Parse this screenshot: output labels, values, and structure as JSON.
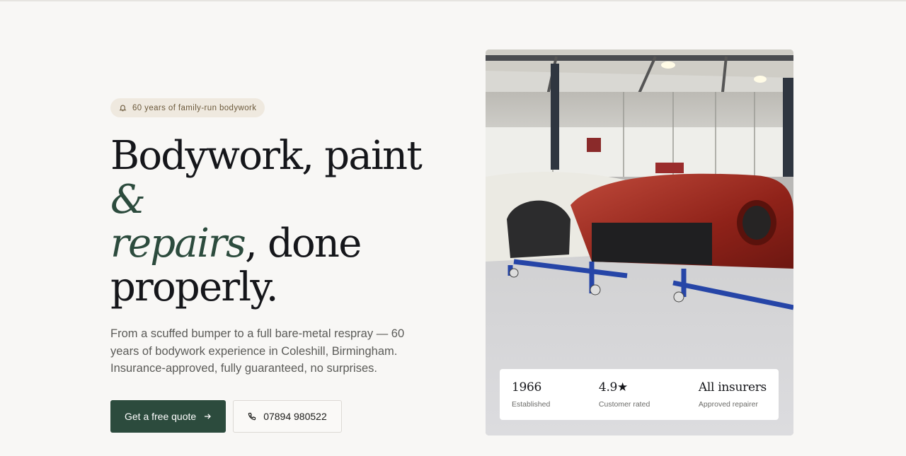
{
  "hero": {
    "badge": "60 years of family-run bodywork",
    "headline": {
      "part1": "Bodywork, paint ",
      "amp": "&",
      "accent": "repairs",
      "part2": ", done",
      "part3": "properly."
    },
    "subtext": "From a scuffed bumper to a full bare-metal respray — 60 years of bodywork experience in Coleshill, Birmingham. Insurance-approved, fully guaranteed, no surprises.",
    "primary_cta": "Get a free quote",
    "phone": "07894 980522"
  },
  "stats": [
    {
      "value": "1966",
      "label": "Established"
    },
    {
      "value": "4.9★",
      "label": "Customer rated"
    },
    {
      "value": "All insurers",
      "label": "Approved repairer"
    }
  ],
  "colors": {
    "accent": "#2c4b3d",
    "background": "#f8f7f5",
    "badge": "#efe9df"
  },
  "icons": {
    "badge": "bell-icon",
    "cta": "arrow-right-icon",
    "phone": "phone-icon"
  }
}
